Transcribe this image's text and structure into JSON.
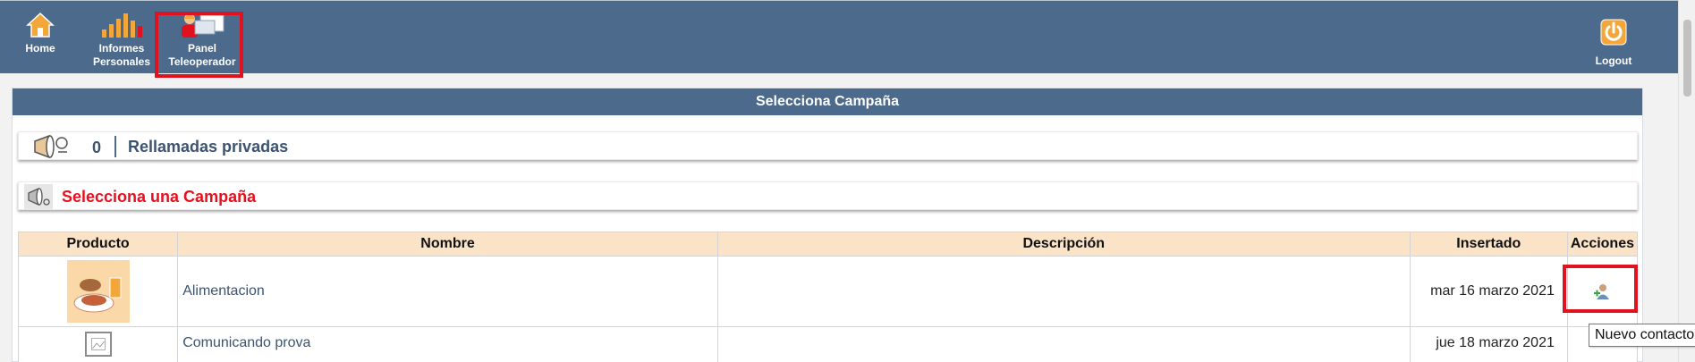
{
  "nav": {
    "home_label": "Home",
    "informes_label_1": "Informes",
    "informes_label_2": "Personales",
    "panel_label_1": "Panel",
    "panel_label_2": "Teleoperador",
    "logout_label": "Logout"
  },
  "panel": {
    "title": "Selecciona Campaña",
    "recalls": {
      "count": "0",
      "label": "Rellamadas privadas"
    },
    "select_label": "Selecciona una Campaña"
  },
  "table": {
    "headers": [
      "Producto",
      "Nombre",
      "Descripción",
      "Insertado",
      "Acciones"
    ],
    "rows": [
      {
        "name": "Alimentacion",
        "description": "",
        "inserted": "mar 16 marzo 2021",
        "product_icon": "food-image",
        "action_icon": "new-contact-icon"
      },
      {
        "name": "Comunicando prova",
        "description": "",
        "inserted": "jue 18 marzo 2021",
        "product_icon": "broken-image-icon"
      }
    ]
  },
  "tooltip": {
    "text": "Nuevo contacto"
  },
  "colors": {
    "header_bg": "#4c6a8b",
    "table_header_bg": "#fbe3c8",
    "highlight": "#e0121f",
    "alert_text": "#e8101c"
  }
}
